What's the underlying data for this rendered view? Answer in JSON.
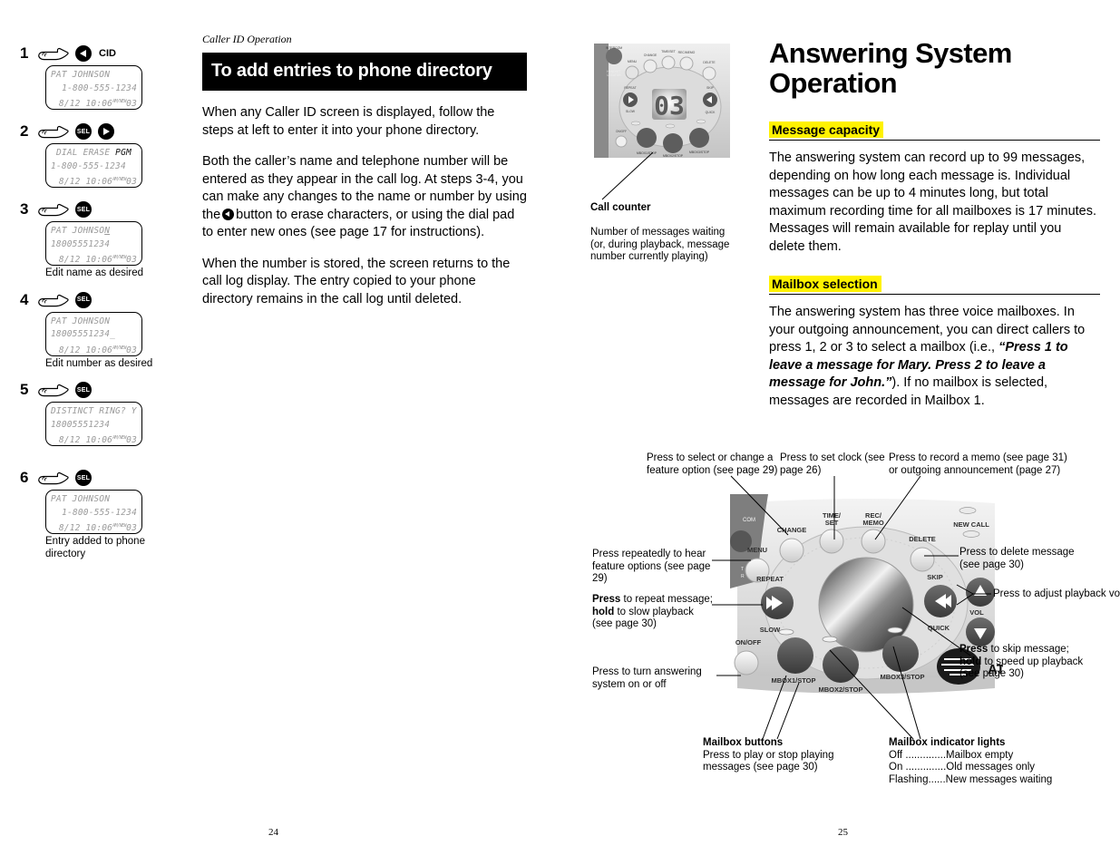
{
  "left_column": {
    "steps": [
      {
        "number": "1",
        "buttons": [
          {
            "type": "tri-left",
            "label": ""
          }
        ],
        "side_label": "CID",
        "lcd": {
          "line1": "PAT JOHNSON",
          "line1_align": "left",
          "line2": "1-800-555-1234",
          "line2_align": "right",
          "line3_date": "8/12 10:06",
          "line3_sup": "AM/NEW",
          "line3_count": "03"
        },
        "caption": ""
      },
      {
        "number": "2",
        "buttons": [
          {
            "type": "sel",
            "label": "SEL"
          },
          {
            "type": "tri-right",
            "label": ""
          }
        ],
        "side_label": "",
        "lcd": {
          "line1": "DIAL ERASE ",
          "line1_black": "PGM",
          "line1_align": "center",
          "line2": "1-800-555-1234",
          "line2_align": "left",
          "line3_date": "8/12 10:06",
          "line3_sup": "AM/NEW",
          "line3_count": "03"
        },
        "caption": ""
      },
      {
        "number": "3",
        "buttons": [
          {
            "type": "sel",
            "label": "SEL"
          }
        ],
        "side_label": "",
        "lcd": {
          "line1": "PAT JOHNSO",
          "line1_cursor": "N",
          "line1_align": "left",
          "line2": "18005551234",
          "line2_align": "left",
          "line3_date": "8/12 10:06",
          "line3_sup": "AM/NEW",
          "line3_count": "03"
        },
        "caption": "Edit name as desired"
      },
      {
        "number": "4",
        "buttons": [
          {
            "type": "sel",
            "label": "SEL"
          }
        ],
        "side_label": "",
        "lcd": {
          "line1": "PAT JOHNSON",
          "line1_align": "left",
          "line2": "18005551234_",
          "line2_align": "left",
          "line3_date": "8/12 10:06",
          "line3_sup": "AM/NEW",
          "line3_count": "03"
        },
        "caption": "Edit number as desired"
      },
      {
        "number": "5",
        "buttons": [
          {
            "type": "sel",
            "label": "SEL"
          }
        ],
        "side_label": "",
        "lcd": {
          "line1": "DISTINCT RING? Y",
          "line1_align": "left",
          "line2": "18005551234",
          "line2_align": "left",
          "line3_date": "8/12 10:06",
          "line3_sup": "AM/NEW",
          "line3_count": "03"
        },
        "caption": ""
      },
      {
        "number": "6",
        "buttons": [
          {
            "type": "sel",
            "label": "SEL"
          }
        ],
        "side_label": "",
        "lcd": {
          "line1": "PAT JOHNSON",
          "line1_align": "left",
          "line2": "1-800-555-1234",
          "line2_align": "right",
          "line3_date": "8/12 10:06",
          "line3_sup": "AM/NEW",
          "line3_count": "03"
        },
        "caption": "Entry added to phone directory"
      }
    ]
  },
  "middle_column": {
    "running_head": "Caller ID Operation",
    "section_title": "To add entries to phone directory",
    "paragraph1": "When any Caller ID screen is displayed, follow the steps at left to enter it into your phone directory.",
    "paragraph2_a": "Both the caller’s name and telephone number will be entered as they appear in the call log. At steps 3-4, you can make any changes to the name or number by using the",
    "paragraph2_b": "button to erase characters, or using the dial pad to enter new ones (see page 17 for instructions).",
    "paragraph3": "When the number is stored, the screen returns to the call log display. The entry copied to your phone directory remains in the call log until deleted."
  },
  "right_column": {
    "title": "Answering System Operation",
    "sections": [
      {
        "heading": "Message capacity",
        "body": "The answering system can record up to 99 messages, depending on how long each message is. Individual messages can be up to 4 minutes long, but total maximum recording time for all mailboxes is 17 minutes. Messages will remain available for replay until you delete them."
      },
      {
        "heading": "Mailbox selection",
        "body_a": "The answering system has three voice mailboxes. In your outgoing announcement, you can direct callers to press 1, 2 or 3 to select a mailbox (i.e.,",
        "body_quote": "“Press 1 to leave a message for Mary. Press 2 to leave a message for John.”",
        "body_b": "). If no mailbox is selected, messages are recorded in Mailbox 1."
      }
    ]
  },
  "call_counter_callout": {
    "title": "Call counter",
    "body": "Number of messages waiting (or, during playback, message number currently playing)"
  },
  "diagram_labels": {
    "change": "Press to select or change a feature option (see page 29)",
    "time_set": "Press to set clock (see page 26)",
    "rec_memo": "Press to record a memo (see page 31) or outgoing announcement (page 27)",
    "menu": "Press repeatedly to hear feature options (see page 29)",
    "repeat_bold": "Press",
    "repeat_rest": " to repeat message;",
    "repeat_bold2": "hold",
    "repeat_rest2": " to slow playback",
    "repeat_line3": "(see page 30)",
    "on_off": "Press to turn answering system on or off",
    "delete": "Press to delete message (see page 30)",
    "volume": "Press to adjust playback volume",
    "skip_bold": "Press",
    "skip_rest": " to skip message;",
    "skip_bold2": "hold",
    "skip_rest2": " to speed up playback",
    "skip_line3": "(see page 30)",
    "mailbox_buttons_title": "Mailbox buttons",
    "mailbox_buttons_body": "Press to play or stop playing messages (see page 30)",
    "mailbox_lights_title": "Mailbox indicator lights",
    "mailbox_lights_l1": "Off ..............Mailbox empty",
    "mailbox_lights_l2": "On ..............Old messages only",
    "mailbox_lights_l3": "Flashing......New messages waiting"
  },
  "device_labels": {
    "change": "CHANGE",
    "time_set_1": "TIME/",
    "time_set_2": "SET",
    "rec_1": "REC/",
    "rec_2": "MEMO",
    "menu": "MENU",
    "delete": "DELETE",
    "new_call": "NEW CALL",
    "repeat": "REPEAT",
    "slow": "SLOW",
    "skip": "SKIP",
    "quick": "QUICK",
    "vol": "VOL",
    "on_off": "ON/OFF",
    "mbox1": "MBOX1/STOP",
    "mbox2": "MBOX2/STOP",
    "mbox3": "MBOX3/STOP",
    "intercom": "COM",
    "brand": "AT"
  },
  "page_numbers": {
    "left": "24",
    "right": "25"
  },
  "colors": {
    "highlight": "#FFF200",
    "bar": "#000000",
    "lcd_text": "#9a9a9a"
  }
}
